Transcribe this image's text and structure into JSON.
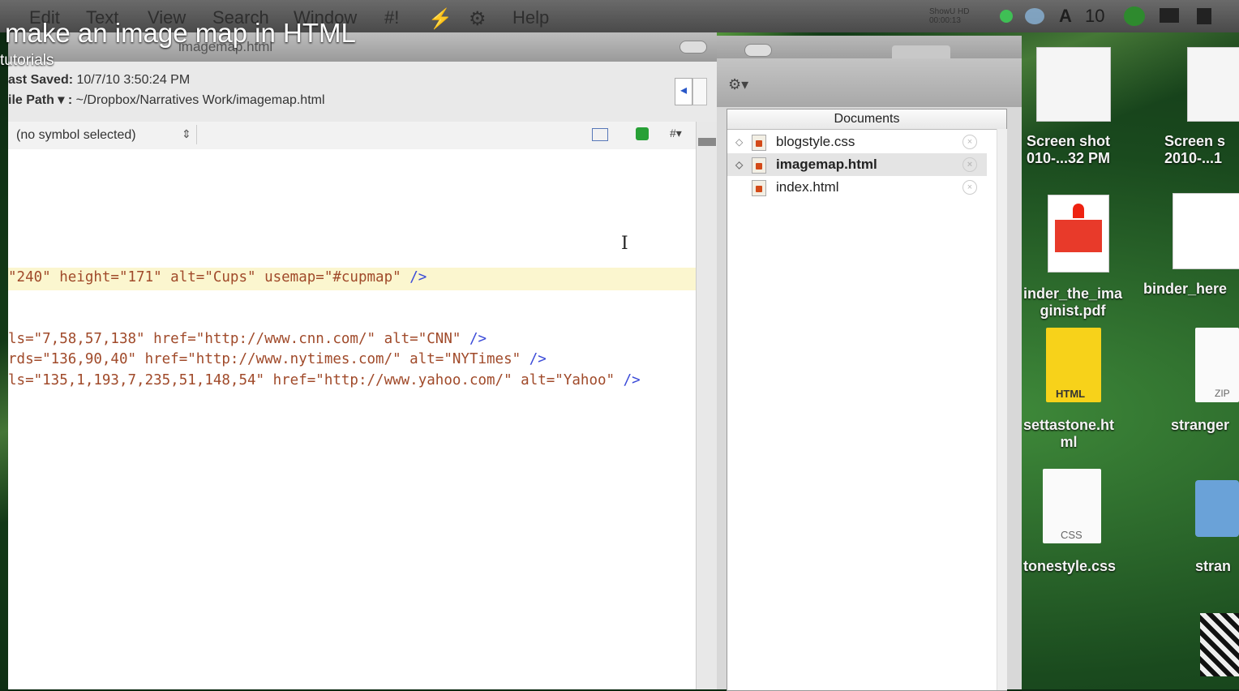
{
  "overlay": {
    "title": "make an image map in HTML",
    "subtitle": "tutorials"
  },
  "menubar": {
    "items": [
      "Edit",
      "Text",
      "View",
      "Search",
      "Window",
      "#!",
      "Help"
    ],
    "status": {
      "recorder_label": "ShowU HD",
      "recorder_time": "00:00:13",
      "font_count": "10"
    }
  },
  "editor": {
    "window_title": "imagemap.html",
    "last_saved_label": "ast Saved:",
    "last_saved_value": "10/7/10 3:50:24 PM",
    "file_path_label": "ile Path ▾ :",
    "file_path_value": "~/Dropbox/Narratives Work/imagemap.html",
    "symbol_select": "(no symbol selected)",
    "code_lines": [
      {
        "text": "\"240\" height=\"171\" alt=\"Cups\" usemap=\"#cupmap\" ",
        "end": "/>"
      },
      {
        "text": "ls=\"7,58,57,138\" href=\"http://www.cnn.com/\" alt=\"CNN\" ",
        "end": "/>"
      },
      {
        "text": "rds=\"136,90,40\" href=\"http://www.nytimes.com/\" alt=\"NYTimes\" ",
        "end": "/>"
      },
      {
        "text": "ls=\"135,1,193,7,235,51,148,54\" href=\"http://www.yahoo.com/\" alt=\"Yahoo\" ",
        "end": "/>"
      }
    ]
  },
  "drawer": {
    "header": "Documents",
    "documents": [
      {
        "name": "blogstyle.css",
        "selected": false
      },
      {
        "name": "imagemap.html",
        "selected": true
      },
      {
        "name": "index.html",
        "selected": false
      }
    ]
  },
  "desktop": {
    "icons": [
      {
        "label_line1": "Screen shot",
        "label_line2": "010-...32 PM"
      },
      {
        "label_line1": "Screen s",
        "label_line2": "2010-...1"
      },
      {
        "label_line1": "inder_the_ima",
        "label_line2": "ginist.pdf"
      },
      {
        "label_line1": "binder_here",
        "label_line2": ""
      },
      {
        "label_line1": "settastone.ht",
        "label_line2": "ml",
        "badge": "HTML"
      },
      {
        "label_line1": "stranger",
        "label_line2": "",
        "badge": "ZIP"
      },
      {
        "label_line1": "tonestyle.css",
        "label_line2": "",
        "badge": "CSS"
      },
      {
        "label_line1": "stran",
        "label_line2": ""
      }
    ]
  }
}
